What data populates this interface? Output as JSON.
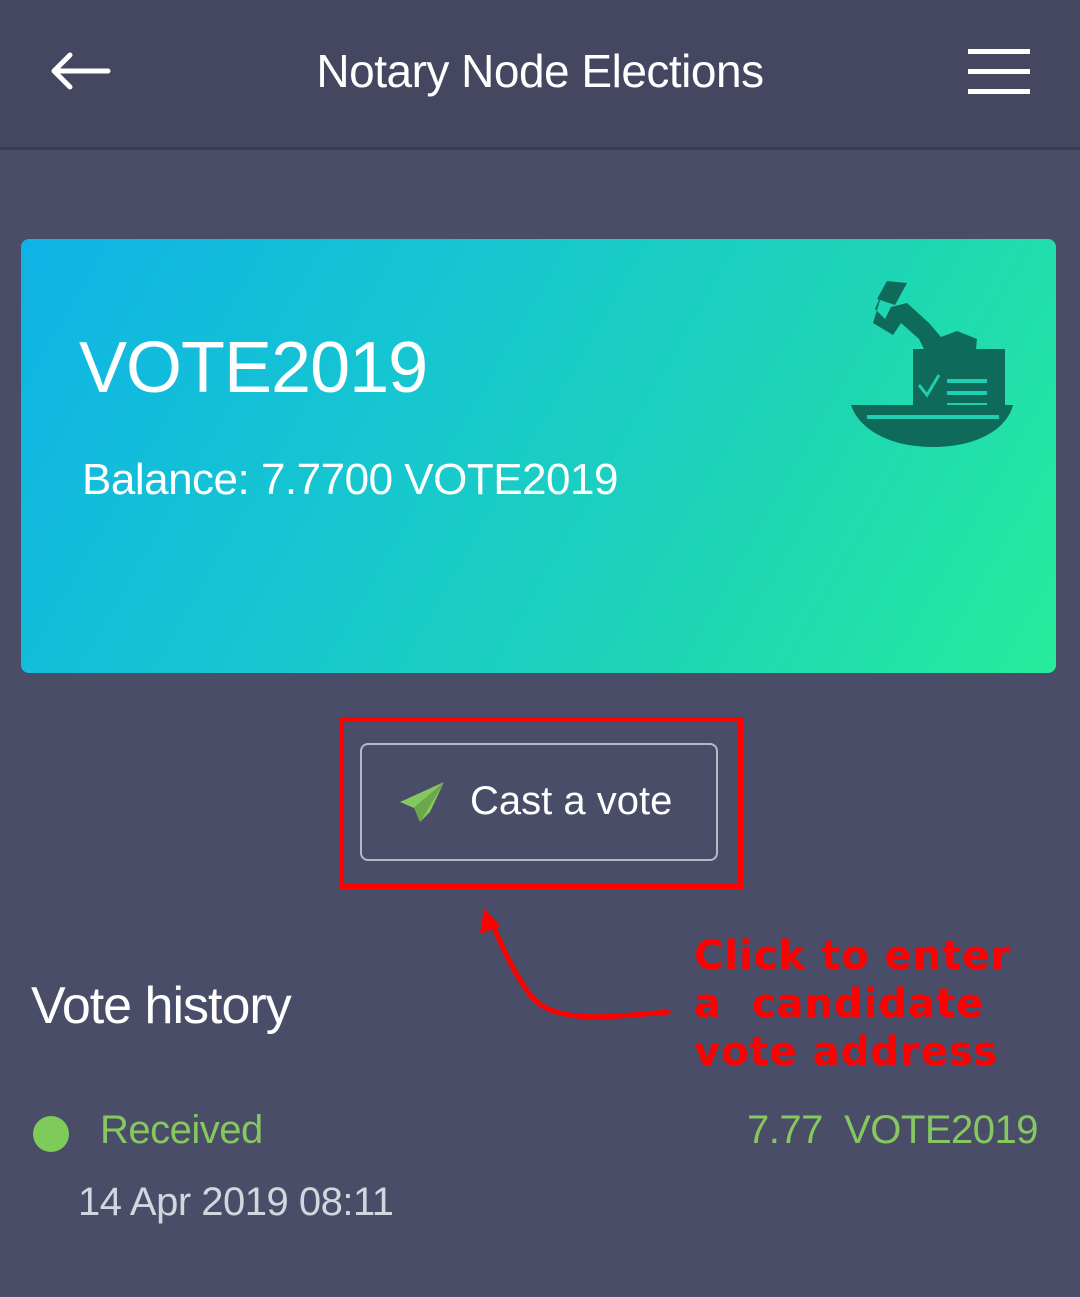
{
  "header": {
    "title": "Notary Node Elections",
    "back_icon": "arrow-left-icon",
    "menu_icon": "hamburger-menu-icon"
  },
  "token_card": {
    "name": "VOTE2019",
    "balance_text": "Balance: 7.7700 VOTE2019",
    "icon": "ballot-box-icon"
  },
  "cast_vote": {
    "label": "Cast a vote",
    "icon": "send-paper-plane-icon"
  },
  "annotation": {
    "text": "Click to enter\na  candidate\nvote address"
  },
  "history": {
    "title": "Vote history",
    "items": [
      {
        "status": "Received",
        "amount": "7.77  VOTE2019",
        "date": "14 Apr 2019 08:11"
      }
    ]
  },
  "colors": {
    "background": "#4a4d68",
    "header_bg": "#454761",
    "card_gradient_start": "#0fb3e6",
    "card_gradient_end": "#26ec9c",
    "received_green": "#86c760",
    "annotation_red": "#ff0000"
  }
}
